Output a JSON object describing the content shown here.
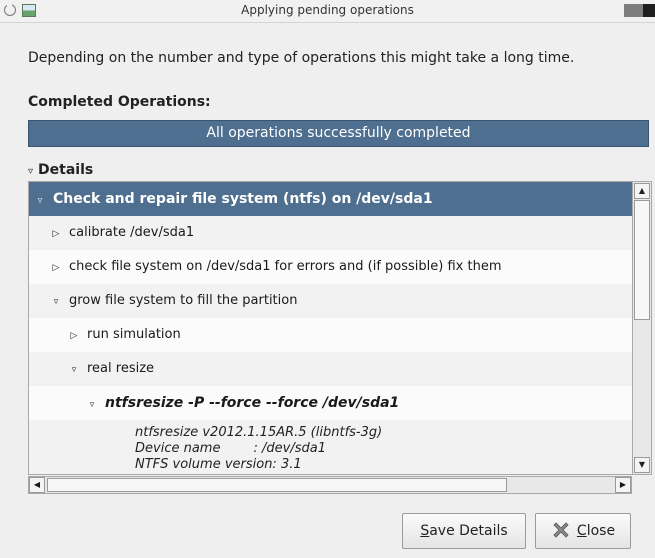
{
  "window": {
    "title": "Applying pending operations"
  },
  "intro_text": "Depending on the number and type of operations this might take a long time.",
  "completed": {
    "heading": "Completed Operations:",
    "status": "All operations successfully completed"
  },
  "details": {
    "label": "Details",
    "rows": [
      {
        "text": "Check and repair file system (ntfs) on /dev/sda1",
        "expander": "▿"
      },
      {
        "text": "calibrate /dev/sda1",
        "expander": "▷"
      },
      {
        "text": "check file system on /dev/sda1 for errors and (if possible) fix them",
        "expander": "▷"
      },
      {
        "text": "grow file system to fill the partition",
        "expander": "▿"
      },
      {
        "text": "run simulation",
        "expander": "▷"
      },
      {
        "text": "real resize",
        "expander": "▿"
      },
      {
        "text": "ntfsresize -P --force --force /dev/sda1",
        "expander": "▿"
      }
    ],
    "output_lines": [
      "ntfsresize v2012.1.15AR.5 (libntfs-3g)",
      "Device name        : /dev/sda1",
      "NTFS volume version: 3.1"
    ]
  },
  "buttons": {
    "save_details": {
      "underlined": "S",
      "rest": "ave Details"
    },
    "close": {
      "underlined": "C",
      "rest": "lose"
    }
  }
}
